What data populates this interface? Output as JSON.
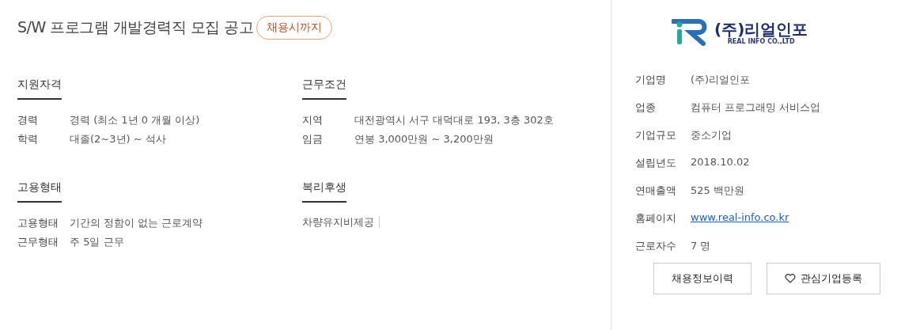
{
  "title": "S/W 프로그램 개발경력직 모집 공고",
  "deadline_badge": "채용시까지",
  "sections": [
    {
      "heading": "지원자격",
      "rows": [
        {
          "label": "경력",
          "value": "경력 (최소 1년 0 개월 이상)"
        },
        {
          "label": "학력",
          "value": "대졸(2~3년) ~ 석사"
        }
      ]
    },
    {
      "heading": "근무조건",
      "rows": [
        {
          "label": "지역",
          "value": "대전광역시 서구 대덕대로 193, 3층 302호"
        },
        {
          "label": "임금",
          "value": "연봉 3,000만원 ~ 3,200만원"
        }
      ]
    },
    {
      "heading": "고용형태",
      "rows": [
        {
          "label": "고용형태",
          "value": "기간의 정함이 없는 근로계약"
        },
        {
          "label": "근무형태",
          "value": "주 5일 근무"
        }
      ]
    },
    {
      "heading": "복리후생",
      "tags": [
        "차량유지비제공"
      ]
    }
  ],
  "company": {
    "logo": {
      "name": "(주)리얼인포",
      "subtitle": "REAL INFO CO.,LTD"
    },
    "info": [
      {
        "label": "기업명",
        "value": "(주)리얼인포"
      },
      {
        "label": "업종",
        "value": "컴퓨터 프로그래밍 서비스업"
      },
      {
        "label": "기업규모",
        "value": "중소기업"
      },
      {
        "label": "설립년도",
        "value": "2018.10.02"
      },
      {
        "label": "연매출액",
        "value": "525 백만원"
      },
      {
        "label": "홈페이지",
        "value": "www.real-info.co.kr",
        "kind": "link"
      },
      {
        "label": "근로자수",
        "value": "7 명"
      }
    ],
    "buttons": [
      {
        "label": "채용정보이력",
        "kind": "plain"
      },
      {
        "label": "관심기업등록",
        "kind": "heart"
      }
    ]
  }
}
